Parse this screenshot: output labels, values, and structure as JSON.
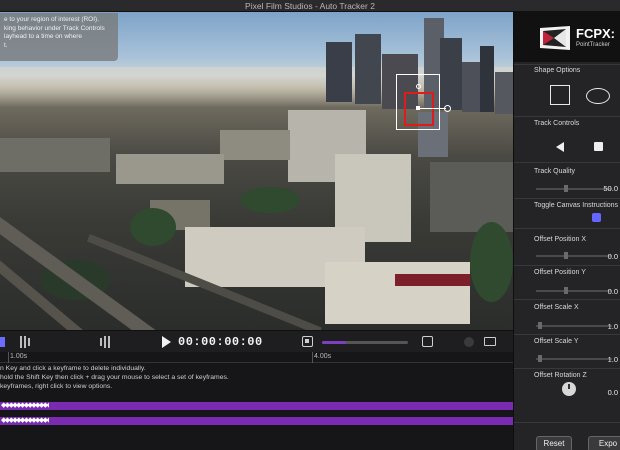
{
  "window": {
    "title": "Pixel Film Studios - Auto Tracker 2"
  },
  "tooltip": {
    "lines": [
      "e to your region of interest (ROI).",
      "king behavior under Track Controls",
      "",
      "layhead to a time on where",
      "t."
    ]
  },
  "transport": {
    "timecode": "00:00:00:00",
    "progress_fraction": 0.28
  },
  "timeline": {
    "ruler": {
      "label_1": "1.00s",
      "label_2": "4.00s"
    },
    "hints": [
      "n Key and click a keyframe to delete individually.",
      "hold the Shift Key then click + drag your mouse to select a set of keyframes.",
      "keyframes, right click to view options."
    ],
    "keyframes": "◆◆◆◆◆◆◆◆◆◆◆◆◆◆◆◆"
  },
  "panel": {
    "brand_title": "FCPX:",
    "brand_subtitle": "PointTracker",
    "shape_options": "Shape Options",
    "track_controls": "Track Controls",
    "track_quality": {
      "label": "Track Quality",
      "value": "50.0"
    },
    "toggle_canvas": "Toggle Canvas Instructions",
    "offset_pos_x": {
      "label": "Offset Position X",
      "value": "0.0"
    },
    "offset_pos_y": {
      "label": "Offset Position Y",
      "value": "0.0"
    },
    "offset_scale_x": {
      "label": "Offset Scale X",
      "value": "1.0"
    },
    "offset_scale_y": {
      "label": "Offset Scale Y",
      "value": "1.0"
    },
    "offset_rot_z": {
      "label": "Offset Rotation Z",
      "value": "0.0"
    },
    "reset_label": "Reset",
    "export_label": "Expo"
  },
  "colors": {
    "accent_purple": "#7a2bb2",
    "roi_red": "#e01b1b",
    "checkbox_blue": "#6467ff"
  },
  "icons": [
    "play-icon",
    "camera-icon",
    "square-shape-icon",
    "ellipse-shape-icon",
    "track-backward-icon",
    "track-stop-icon"
  ]
}
